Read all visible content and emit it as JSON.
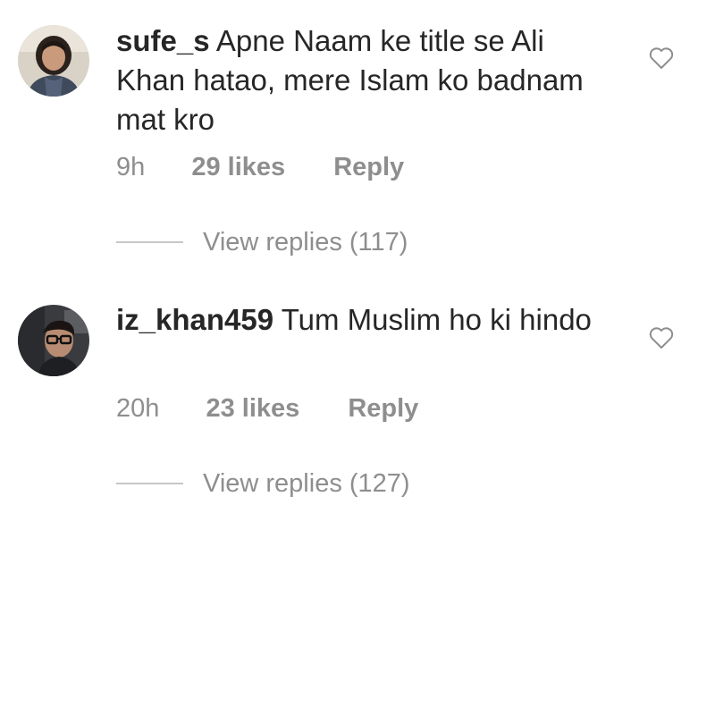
{
  "comments": [
    {
      "username": "sufe_s",
      "text": "Apne Naam ke title se Ali Khan hatao, mere Islam ko badnam mat kro",
      "time": "9h",
      "likes": "29 likes",
      "reply_label": "Reply",
      "view_replies": "View replies (117)",
      "avatar_icon": "avatar-woman-icon",
      "like_icon": "heart-outline-icon"
    },
    {
      "username": "iz_khan459",
      "text": "Tum Muslim ho ki hindo",
      "time": "20h",
      "likes": "23 likes",
      "reply_label": "Reply",
      "view_replies": "View replies (127)",
      "avatar_icon": "avatar-man-glasses-icon",
      "like_icon": "heart-outline-icon"
    }
  ],
  "colors": {
    "primary_text": "#262626",
    "secondary_text": "#8e8e8e",
    "divider": "#c7c7c7",
    "background": "#ffffff"
  }
}
